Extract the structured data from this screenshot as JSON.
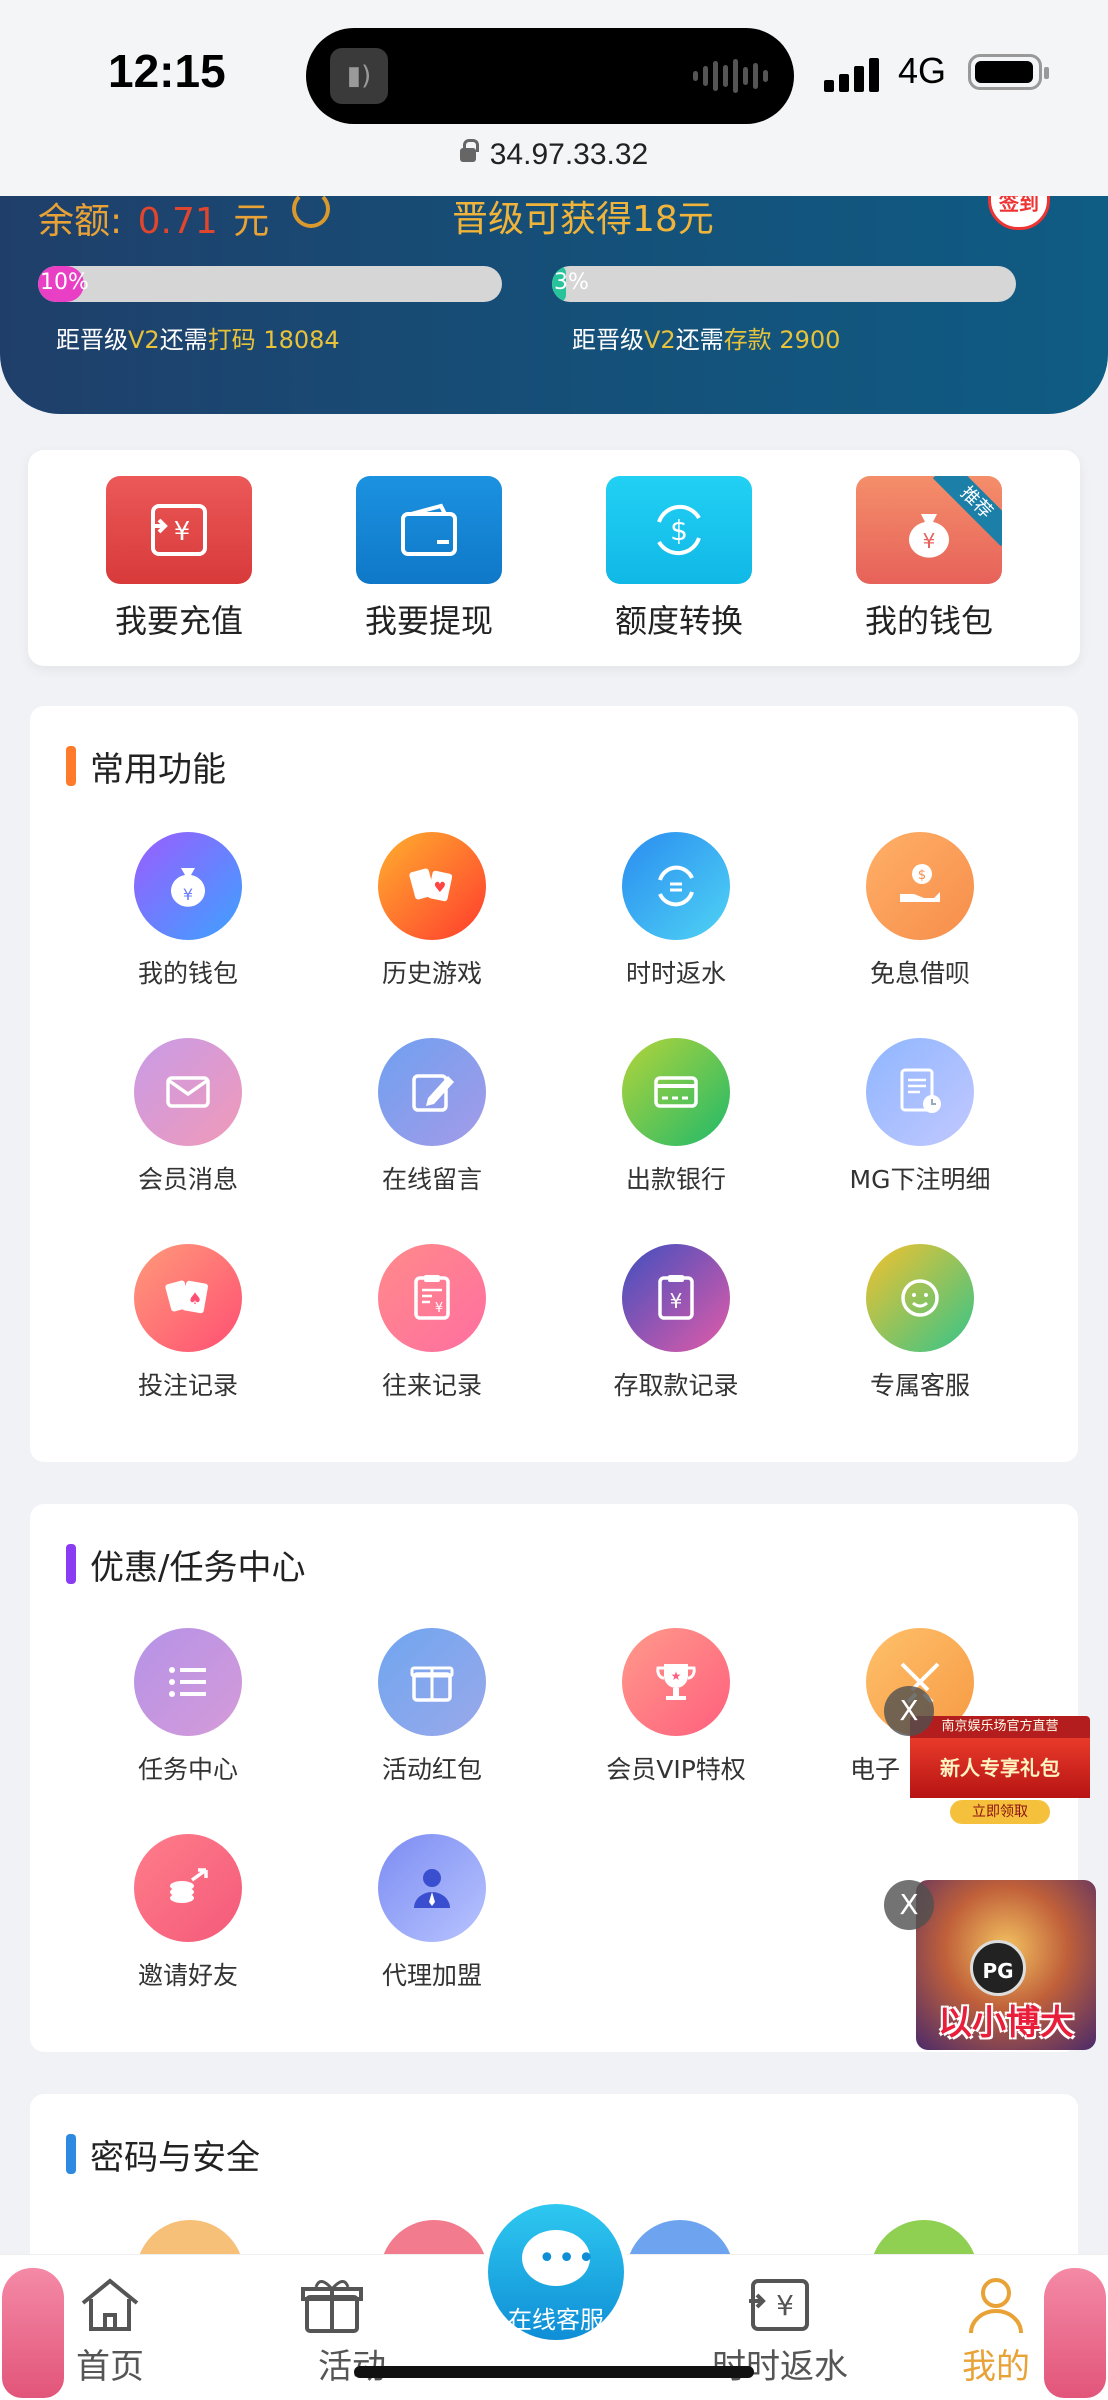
{
  "status_bar": {
    "time": "12:15",
    "network": "4G",
    "url": "34.97.33.32"
  },
  "header": {
    "balance_label": "余额:",
    "balance_value": "0.71",
    "balance_unit": "元",
    "promo_text": "晋级可获得18元",
    "signin_label": "签到",
    "progress": [
      {
        "percent_label": "10%",
        "fraction": 0.1,
        "prefix": "距晋级",
        "level": "V2",
        "mid": "还需",
        "kind": "打码",
        "amount": "18084"
      },
      {
        "percent_label": "3%",
        "fraction": 0.03,
        "prefix": "距晋级",
        "level": "V2",
        "mid": "还需",
        "kind": "存款",
        "amount": "2900"
      }
    ]
  },
  "quick_actions": [
    {
      "label": "我要充值",
      "icon": "deposit-icon",
      "color": "#e24a4a"
    },
    {
      "label": "我要提现",
      "icon": "withdraw-wallet-icon",
      "color": "#1686d6"
    },
    {
      "label": "额度转换",
      "icon": "transfer-icon",
      "color": "#18c6ef"
    },
    {
      "label": "我的钱包",
      "icon": "money-bag-icon",
      "color": "#ef7b60",
      "ribbon": "推荐"
    }
  ],
  "sections": {
    "common": {
      "title": "常用功能",
      "items": [
        {
          "label": "我的钱包",
          "icon": "money-bag-icon"
        },
        {
          "label": "历史游戏",
          "icon": "cards-icon"
        },
        {
          "label": "时时返水",
          "icon": "rebate-icon"
        },
        {
          "label": "免息借呗",
          "icon": "loan-icon"
        },
        {
          "label": "会员消息",
          "icon": "mail-icon"
        },
        {
          "label": "在线留言",
          "icon": "edit-icon"
        },
        {
          "label": "出款银行",
          "icon": "bank-card-icon"
        },
        {
          "label": "MG下注明细",
          "icon": "document-clock-icon"
        },
        {
          "label": "投注记录",
          "icon": "poker-icon"
        },
        {
          "label": "往来记录",
          "icon": "clipboard-yen-icon"
        },
        {
          "label": "存取款记录",
          "icon": "clipboard-money-icon"
        },
        {
          "label": "专属客服",
          "icon": "customer-service-icon"
        }
      ]
    },
    "promo": {
      "title": "优惠/任务中心",
      "items": [
        {
          "label": "任务中心",
          "icon": "list-icon"
        },
        {
          "label": "活动红包",
          "icon": "gift-icon"
        },
        {
          "label": "会员VIP特权",
          "icon": "trophy-icon"
        },
        {
          "label": "电子",
          "icon": "swords-icon"
        },
        {
          "label": "邀请好友",
          "icon": "invite-icon"
        },
        {
          "label": "代理加盟",
          "icon": "agent-icon"
        }
      ]
    },
    "security": {
      "title": "密码与安全"
    }
  },
  "floating_ads": {
    "close_label": "X",
    "ad1": {
      "top": "南京娱乐场官方直营",
      "main": "新人专享礼包",
      "button": "立即领取"
    },
    "ad2": {
      "logo": "PG",
      "slogan": "以小博大"
    }
  },
  "bottom_nav": {
    "tabs": [
      {
        "label": "首页",
        "icon": "home-icon"
      },
      {
        "label": "活动",
        "icon": "gift-icon"
      },
      {
        "label": "时时返水",
        "icon": "rebate-icon"
      },
      {
        "label": "我的",
        "icon": "user-icon",
        "active": true
      }
    ],
    "center": {
      "label": "在线客服",
      "icon": "chat-bubble-icon"
    }
  }
}
